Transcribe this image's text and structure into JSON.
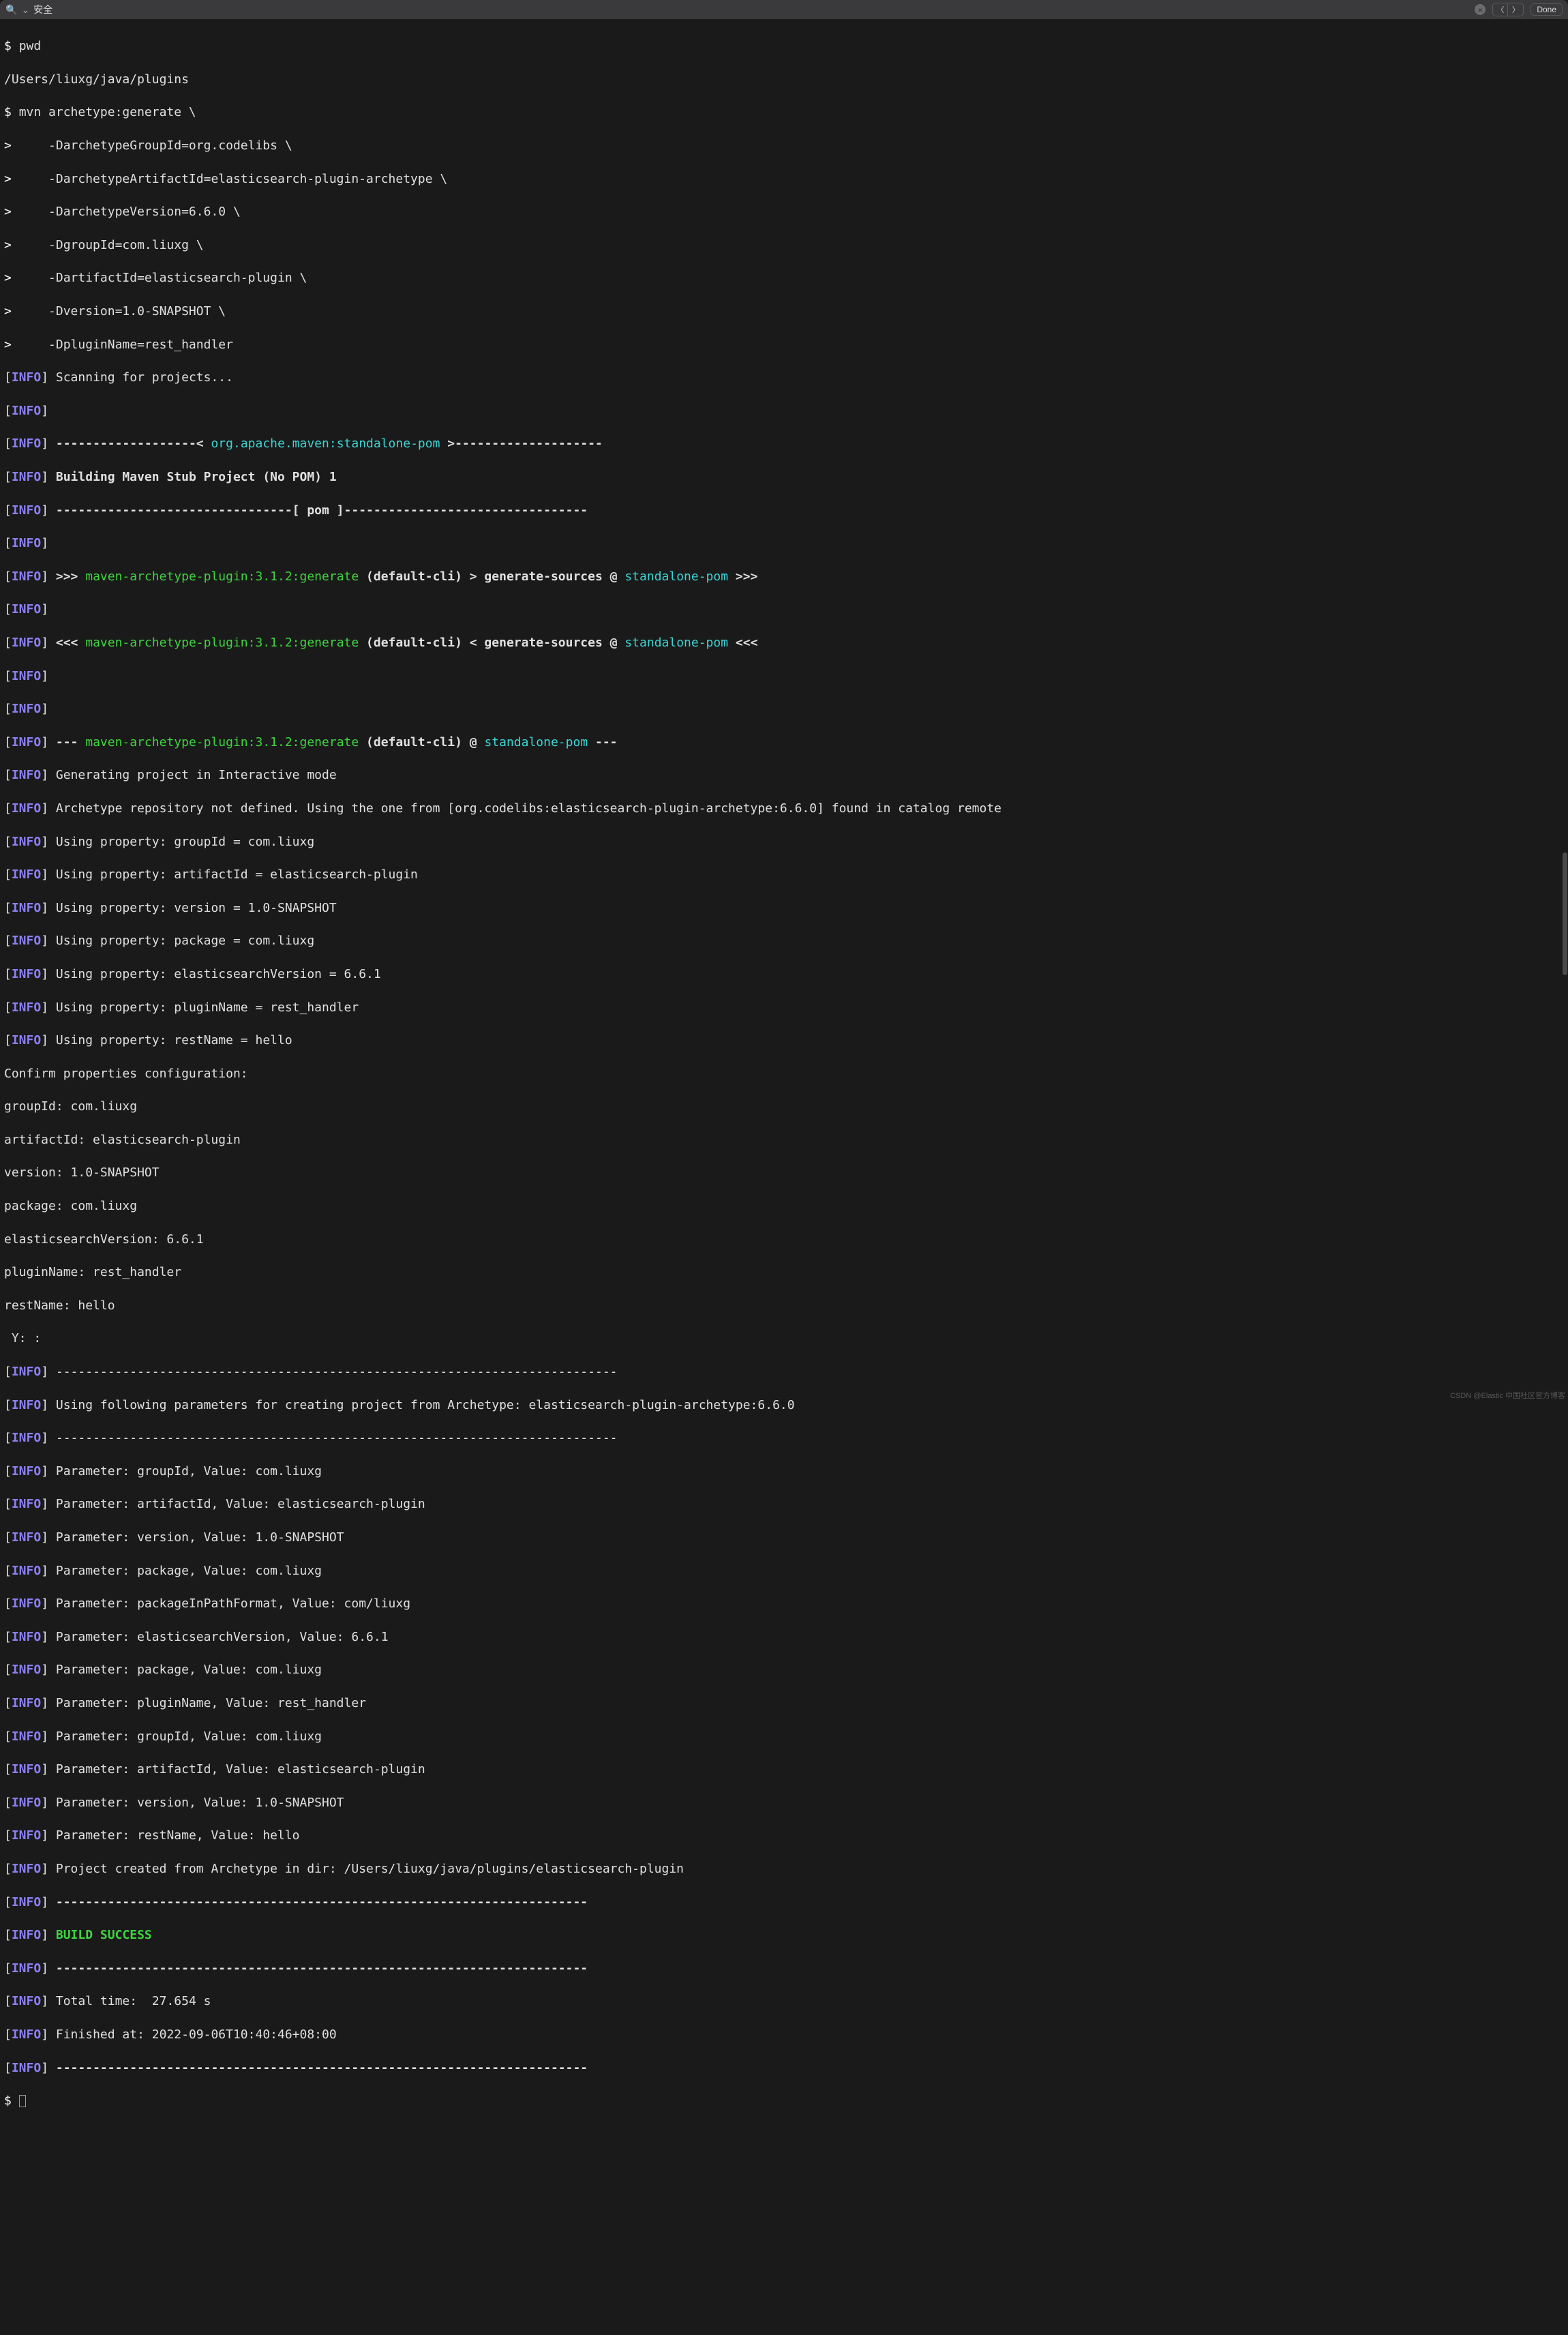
{
  "toolbar": {
    "search_prefix": "⌄",
    "search_value": "安全",
    "done_label": "Done"
  },
  "prompt": "$",
  "cont": ">",
  "info_tag": "INFO",
  "cmd": {
    "pwd": "pwd",
    "pwd_out": "/Users/liuxg/java/plugins",
    "mvn": "mvn archetype:generate \\",
    "l1": "    -DarchetypeGroupId=org.codelibs \\",
    "l2": "    -DarchetypeArtifactId=elasticsearch-plugin-archetype \\",
    "l3": "    -DarchetypeVersion=6.6.0 \\",
    "l4": "    -DgroupId=com.liuxg \\",
    "l5": "    -DartifactId=elasticsearch-plugin \\",
    "l6": "    -Dversion=1.0-SNAPSHOT \\",
    "l7": "    -DpluginName=rest_handler"
  },
  "msg": {
    "scanning": " Scanning for projects...",
    "dash_open": " -------------------< ",
    "pom_coord": "org.apache.maven:standalone-pom",
    "dash_close": " >--------------------",
    "building": " Building Maven Stub Project (No POM) 1",
    "pom_rule": " --------------------------------[ pom ]---------------------------------",
    "gg_fwd1": " >>> ",
    "plugin_goal": "maven-archetype-plugin:3.1.2:generate",
    "gg_fwd2": " (default-cli) > generate-sources @ ",
    "standalone": "standalone-pom",
    "gg_fwd3": " >>>",
    "gg_bwd1": " <<< ",
    "gg_bwd2": " (default-cli) < generate-sources @ ",
    "gg_bwd3": " <<<",
    "run1": " --- ",
    "run2": " (default-cli) @ ",
    "run3": " ---",
    "interactive": " Generating project in Interactive mode",
    "repo": " Archetype repository not defined. Using the one from [org.codelibs:elasticsearch-plugin-archetype:6.6.0] found in catalog remote",
    "p_group": " Using property: groupId = com.liuxg",
    "p_artifact": " Using property: artifactId = elasticsearch-plugin",
    "p_version": " Using property: version = 1.0-SNAPSHOT",
    "p_package": " Using property: package = com.liuxg",
    "p_esv": " Using property: elasticsearchVersion = 6.6.1",
    "p_plugin": " Using property: pluginName = rest_handler",
    "p_rest": " Using property: restName = hello",
    "confirm": "Confirm properties configuration:",
    "c_group": "groupId: com.liuxg",
    "c_artifact": "artifactId: elasticsearch-plugin",
    "c_version": "version: 1.0-SNAPSHOT",
    "c_package": "package: com.liuxg",
    "c_esv": "elasticsearchVersion: 6.6.1",
    "c_plugin": "pluginName: rest_handler",
    "c_rest": "restName: hello",
    "y": " Y: :",
    "rule": " ----------------------------------------------------------------------------",
    "following": " Using following parameters for creating project from Archetype: elasticsearch-plugin-archetype:6.6.0",
    "pr_group": " Parameter: groupId, Value: com.liuxg",
    "pr_artifact": " Parameter: artifactId, Value: elasticsearch-plugin",
    "pr_version": " Parameter: version, Value: 1.0-SNAPSHOT",
    "pr_package": " Parameter: package, Value: com.liuxg",
    "pr_pip": " Parameter: packageInPathFormat, Value: com/liuxg",
    "pr_esv": " Parameter: elasticsearchVersion, Value: 6.6.1",
    "pr_package2": " Parameter: package, Value: com.liuxg",
    "pr_plugin": " Parameter: pluginName, Value: rest_handler",
    "pr_group2": " Parameter: groupId, Value: com.liuxg",
    "pr_artifact2": " Parameter: artifactId, Value: elasticsearch-plugin",
    "pr_version2": " Parameter: version, Value: 1.0-SNAPSHOT",
    "pr_rest": " Parameter: restName, Value: hello",
    "created": " Project created from Archetype in dir: /Users/liuxg/java/plugins/elasticsearch-plugin",
    "rule72": " ------------------------------------------------------------------------",
    "success": " BUILD SUCCESS",
    "total": " Total time:  27.654 s",
    "finished": " Finished at: 2022-09-06T10:40:46+08:00"
  },
  "watermark": "CSDN @Elastic 中国社区官方博客"
}
